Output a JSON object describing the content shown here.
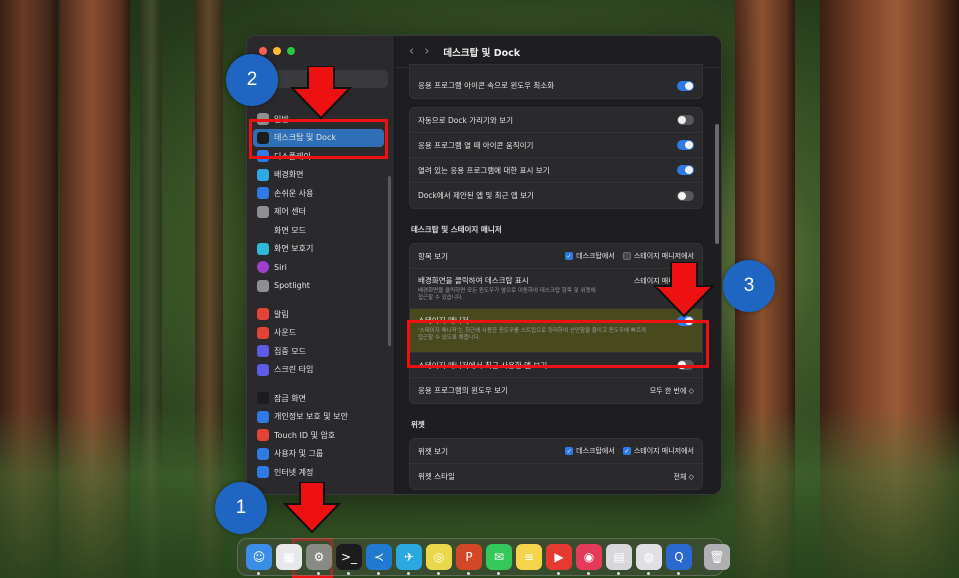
{
  "window": {
    "title": "데스크탑 및 Dock",
    "nav_back": "‹",
    "nav_forward": "›"
  },
  "sidebar": {
    "items": [
      {
        "label": "일반",
        "icon": "gear-icon",
        "color": "#8e8e93"
      },
      {
        "label": "데스크탑 및 Dock",
        "icon": "dock-icon",
        "color": "#1c1c1e",
        "active": true
      },
      {
        "label": "디스플레이",
        "icon": "display-icon",
        "color": "#2f7ae5"
      },
      {
        "label": "배경화면",
        "icon": "wallpaper-icon",
        "color": "#2fa8e5"
      },
      {
        "label": "손쉬운 사용",
        "icon": "accessibility-icon",
        "color": "#2f7ae5"
      },
      {
        "label": "제어 센터",
        "icon": "control-center-icon",
        "color": "#8e8e93"
      },
      {
        "label": "화면 모드",
        "icon": "appearance-icon",
        "color": "#2a2a2c"
      },
      {
        "label": "화면 보호기",
        "icon": "screensaver-icon",
        "color": "#2fb8d8"
      },
      {
        "label": "Siri",
        "icon": "siri-icon",
        "color": "#a040d0"
      },
      {
        "label": "Spotlight",
        "icon": "spotlight-icon",
        "color": "#8e8e93"
      },
      {
        "label": "알림",
        "icon": "notifications-icon",
        "color": "#e5433a"
      },
      {
        "label": "사운드",
        "icon": "sound-icon",
        "color": "#e5433a"
      },
      {
        "label": "집중 모드",
        "icon": "focus-icon",
        "color": "#5e5ce6"
      },
      {
        "label": "스크린 타임",
        "icon": "screentime-icon",
        "color": "#5e5ce6"
      },
      {
        "label": "잠금 화면",
        "icon": "lock-icon",
        "color": "#1c1c1e"
      },
      {
        "label": "개인정보 보호 및 보안",
        "icon": "privacy-hand-icon",
        "color": "#2f7ae5"
      },
      {
        "label": "Touch ID 및 암호",
        "icon": "fingerprint-icon",
        "color": "#e5433a"
      },
      {
        "label": "사용자 및 그룹",
        "icon": "users-icon",
        "color": "#2f7ae5"
      },
      {
        "label": "인터넷 계정",
        "icon": "at-icon",
        "color": "#2f7ae5"
      }
    ]
  },
  "dock_section": {
    "rows": [
      {
        "label": "응용 프로그램 아이콘 속으로 윈도우 최소화",
        "on": true
      },
      {
        "label": "자동으로 Dock 가리기와 보기",
        "on": false
      },
      {
        "label": "응용 프로그램 열 때 아이콘 움직이기",
        "on": true
      },
      {
        "label": "열려 있는 응용 프로그램에 대한 표시 보기",
        "on": true
      },
      {
        "label": "Dock에서 제안된 앱 및 최근 앱 보기",
        "on": false
      }
    ]
  },
  "stage_section": {
    "heading": "데스크탑 및 스테이지 매니저",
    "show_items_label": "항목 보기",
    "show_items_desktop": "데스크탑에서",
    "show_items_stage": "스테이지 매니저에서",
    "click_wallpaper_label": "배경화면을 클릭하여 데스크탑 표시",
    "click_wallpaper_value": "스테이지 매니저에서",
    "click_wallpaper_sub": "배경화면을 클릭하면 모든 윈도우가 옆으로 이동하여 데스크탑 항목 및 위젯에 접근할 수 있습니다.",
    "stage_manager_label": "스테이지 매니저",
    "stage_manager_sub": "'스테이지 매니저'는 최근에 사용한 윈도우를 스트립으로 정리하여 산만함을 줄이고 윈도우에 빠르게 접근할 수 있도록 해줍니다.",
    "stage_manager_on": true,
    "recent_apps_label": "스테이지 매니저에서 최근 사용한 앱 보기",
    "recent_apps_on": false,
    "app_windows_label": "응용 프로그램의 윈도우 보기",
    "app_windows_value": "모두 한 번에 ◇"
  },
  "widgets_section": {
    "heading": "위젯",
    "show_widgets_label": "위젯 보기",
    "show_widgets_desktop": "데스크탑에서",
    "show_widgets_stage": "스테이지 매니저에서",
    "widget_style_label": "위젯 스타일",
    "widget_style_value": "전체 ◇"
  },
  "annotations": {
    "step1": "1",
    "step2": "2",
    "step3": "3"
  },
  "dock": {
    "apps": [
      {
        "name": "finder-icon",
        "glyph": "☺",
        "color": "#3a8ee8"
      },
      {
        "name": "launchpad-icon",
        "glyph": "▦",
        "color": "#e8e8ea"
      },
      {
        "name": "system-settings-icon",
        "glyph": "⚙",
        "color": "#8a8a84"
      },
      {
        "name": "terminal-icon",
        "glyph": ">_",
        "color": "#1c1c1e"
      },
      {
        "name": "vscode-icon",
        "glyph": "≺",
        "color": "#1f7ad0"
      },
      {
        "name": "bird-app-icon",
        "glyph": "✈",
        "color": "#2aa8e0"
      },
      {
        "name": "chrome-icon",
        "glyph": "◎",
        "color": "#e8d84a"
      },
      {
        "name": "powerpoint-icon",
        "glyph": "P",
        "color": "#d24726"
      },
      {
        "name": "messages-icon",
        "glyph": "✉",
        "color": "#34c759"
      },
      {
        "name": "notes-icon",
        "glyph": "≡",
        "color": "#f4d44a"
      },
      {
        "name": "youtube-icon",
        "glyph": "▶",
        "color": "#e53a30"
      },
      {
        "name": "music-player-icon",
        "glyph": "◉",
        "color": "#e53a5a"
      },
      {
        "name": "cards-app-icon",
        "glyph": "▤",
        "color": "#d8d8dc"
      },
      {
        "name": "screenshot-icon",
        "glyph": "◍",
        "color": "#e0e0e4"
      },
      {
        "name": "quicktime-icon",
        "glyph": "Q",
        "color": "#2a6ad0"
      },
      {
        "name": "trash-icon",
        "glyph": "🗑",
        "color": "#b0b0b4"
      }
    ]
  }
}
